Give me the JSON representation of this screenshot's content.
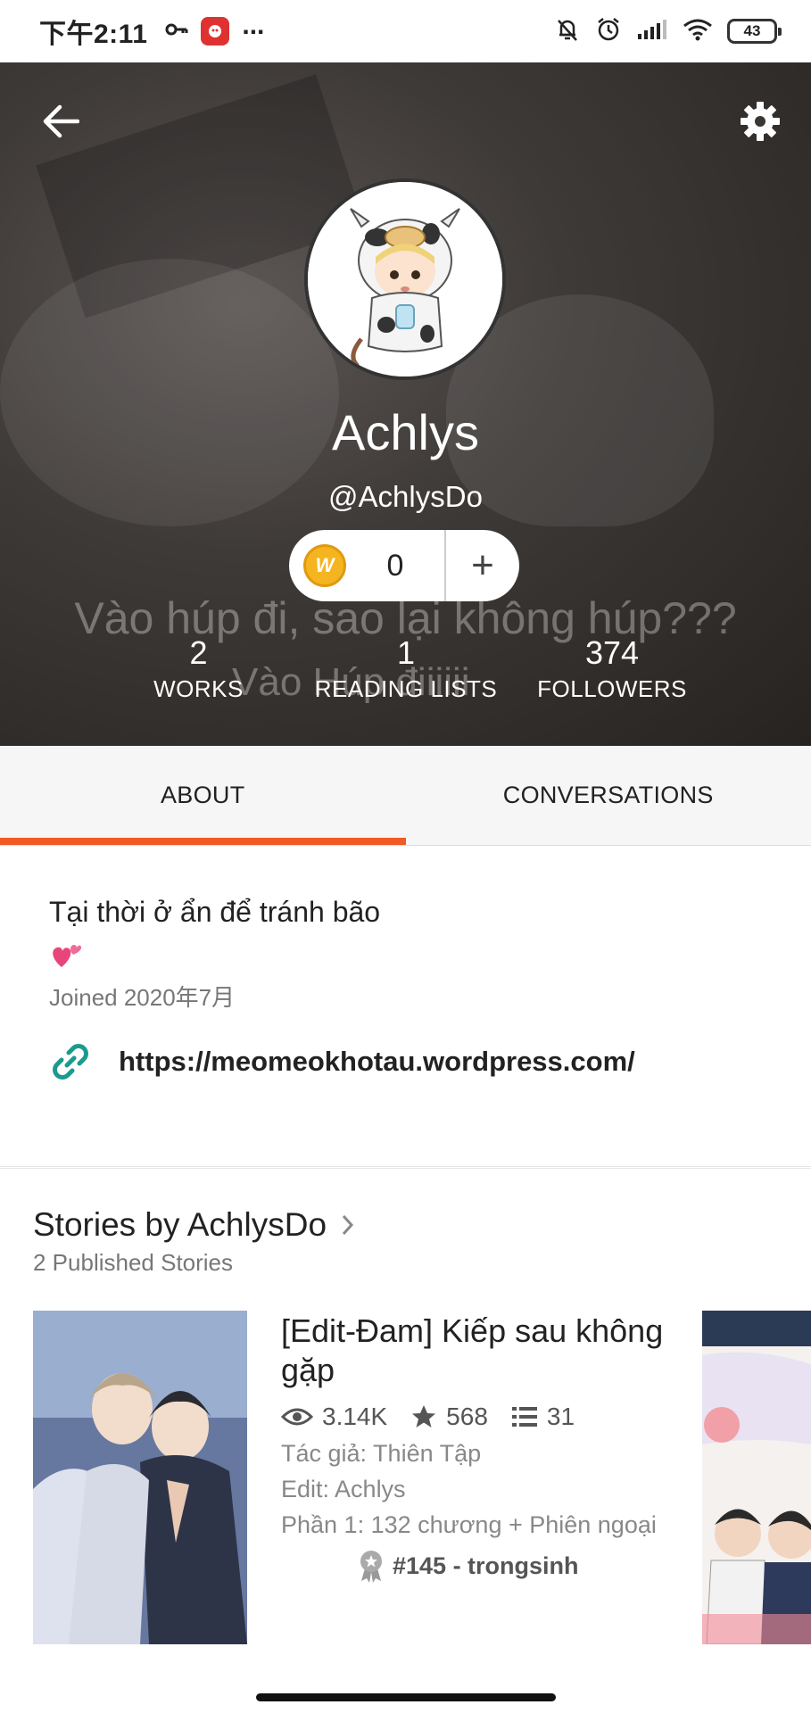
{
  "status_bar": {
    "time": "下午2:11",
    "battery": "43",
    "icons": [
      "key-icon",
      "app-badge-icon",
      "more-dots-icon",
      "mute-bell-icon",
      "alarm-icon",
      "signal-icon",
      "wifi-icon",
      "battery-icon"
    ]
  },
  "header": {
    "display_name": "Achlys",
    "username": "@AchlysDo",
    "overlay_text_line1": "Vào húp đi, sao lại không húp???",
    "overlay_text_line2": "Vào Húp điiiiii",
    "coins": {
      "count": "0",
      "coin_letter": "W",
      "add_label": "+"
    },
    "stats": [
      {
        "number": "2",
        "label": "WORKS"
      },
      {
        "number": "1",
        "label": "READING LISTS"
      },
      {
        "number": "374",
        "label": "FOLLOWERS"
      }
    ]
  },
  "tabs": [
    {
      "label": "ABOUT",
      "active": true
    },
    {
      "label": "CONVERSATIONS",
      "active": false
    }
  ],
  "about": {
    "bio": "Tại thời ở ẩn để tránh bão",
    "joined": "Joined 2020年7月",
    "link": "https://meomeokhotau.wordpress.com/"
  },
  "stories": {
    "title": "Stories by AchlysDo",
    "subtitle": "2 Published Stories",
    "items": [
      {
        "title": "[Edit-Đam] Kiếp sau không gặp",
        "reads": "3.14K",
        "votes": "568",
        "parts": "31",
        "author_line": "Tác giả: Thiên Tập",
        "editor_line": "Edit: Achlys",
        "description": "Phần 1: 132 chương + Phiên ngoại",
        "rank": "#145 - trongsinh"
      }
    ]
  },
  "colors": {
    "accent": "#f15a24",
    "link_icon": "#1a9b8e",
    "coin": "#f4b520"
  }
}
